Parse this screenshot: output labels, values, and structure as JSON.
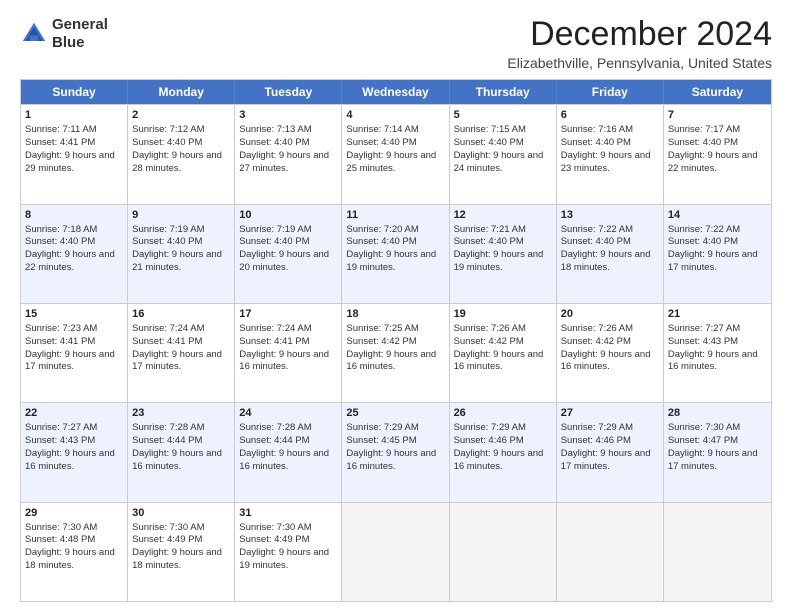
{
  "logo": {
    "line1": "General",
    "line2": "Blue"
  },
  "title": "December 2024",
  "subtitle": "Elizabethville, Pennsylvania, United States",
  "days_of_week": [
    "Sunday",
    "Monday",
    "Tuesday",
    "Wednesday",
    "Thursday",
    "Friday",
    "Saturday"
  ],
  "weeks": [
    [
      {
        "day": "1",
        "rise": "7:11 AM",
        "set": "4:41 PM",
        "daylight": "9 hours and 29 minutes."
      },
      {
        "day": "2",
        "rise": "7:12 AM",
        "set": "4:40 PM",
        "daylight": "9 hours and 28 minutes."
      },
      {
        "day": "3",
        "rise": "7:13 AM",
        "set": "4:40 PM",
        "daylight": "9 hours and 27 minutes."
      },
      {
        "day": "4",
        "rise": "7:14 AM",
        "set": "4:40 PM",
        "daylight": "9 hours and 25 minutes."
      },
      {
        "day": "5",
        "rise": "7:15 AM",
        "set": "4:40 PM",
        "daylight": "9 hours and 24 minutes."
      },
      {
        "day": "6",
        "rise": "7:16 AM",
        "set": "4:40 PM",
        "daylight": "9 hours and 23 minutes."
      },
      {
        "day": "7",
        "rise": "7:17 AM",
        "set": "4:40 PM",
        "daylight": "9 hours and 22 minutes."
      }
    ],
    [
      {
        "day": "8",
        "rise": "7:18 AM",
        "set": "4:40 PM",
        "daylight": "9 hours and 22 minutes."
      },
      {
        "day": "9",
        "rise": "7:19 AM",
        "set": "4:40 PM",
        "daylight": "9 hours and 21 minutes."
      },
      {
        "day": "10",
        "rise": "7:19 AM",
        "set": "4:40 PM",
        "daylight": "9 hours and 20 minutes."
      },
      {
        "day": "11",
        "rise": "7:20 AM",
        "set": "4:40 PM",
        "daylight": "9 hours and 19 minutes."
      },
      {
        "day": "12",
        "rise": "7:21 AM",
        "set": "4:40 PM",
        "daylight": "9 hours and 19 minutes."
      },
      {
        "day": "13",
        "rise": "7:22 AM",
        "set": "4:40 PM",
        "daylight": "9 hours and 18 minutes."
      },
      {
        "day": "14",
        "rise": "7:22 AM",
        "set": "4:40 PM",
        "daylight": "9 hours and 17 minutes."
      }
    ],
    [
      {
        "day": "15",
        "rise": "7:23 AM",
        "set": "4:41 PM",
        "daylight": "9 hours and 17 minutes."
      },
      {
        "day": "16",
        "rise": "7:24 AM",
        "set": "4:41 PM",
        "daylight": "9 hours and 17 minutes."
      },
      {
        "day": "17",
        "rise": "7:24 AM",
        "set": "4:41 PM",
        "daylight": "9 hours and 16 minutes."
      },
      {
        "day": "18",
        "rise": "7:25 AM",
        "set": "4:42 PM",
        "daylight": "9 hours and 16 minutes."
      },
      {
        "day": "19",
        "rise": "7:26 AM",
        "set": "4:42 PM",
        "daylight": "9 hours and 16 minutes."
      },
      {
        "day": "20",
        "rise": "7:26 AM",
        "set": "4:42 PM",
        "daylight": "9 hours and 16 minutes."
      },
      {
        "day": "21",
        "rise": "7:27 AM",
        "set": "4:43 PM",
        "daylight": "9 hours and 16 minutes."
      }
    ],
    [
      {
        "day": "22",
        "rise": "7:27 AM",
        "set": "4:43 PM",
        "daylight": "9 hours and 16 minutes."
      },
      {
        "day": "23",
        "rise": "7:28 AM",
        "set": "4:44 PM",
        "daylight": "9 hours and 16 minutes."
      },
      {
        "day": "24",
        "rise": "7:28 AM",
        "set": "4:44 PM",
        "daylight": "9 hours and 16 minutes."
      },
      {
        "day": "25",
        "rise": "7:29 AM",
        "set": "4:45 PM",
        "daylight": "9 hours and 16 minutes."
      },
      {
        "day": "26",
        "rise": "7:29 AM",
        "set": "4:46 PM",
        "daylight": "9 hours and 16 minutes."
      },
      {
        "day": "27",
        "rise": "7:29 AM",
        "set": "4:46 PM",
        "daylight": "9 hours and 17 minutes."
      },
      {
        "day": "28",
        "rise": "7:30 AM",
        "set": "4:47 PM",
        "daylight": "9 hours and 17 minutes."
      }
    ],
    [
      {
        "day": "29",
        "rise": "7:30 AM",
        "set": "4:48 PM",
        "daylight": "9 hours and 18 minutes."
      },
      {
        "day": "30",
        "rise": "7:30 AM",
        "set": "4:49 PM",
        "daylight": "9 hours and 18 minutes."
      },
      {
        "day": "31",
        "rise": "7:30 AM",
        "set": "4:49 PM",
        "daylight": "9 hours and 19 minutes."
      },
      null,
      null,
      null,
      null
    ]
  ]
}
